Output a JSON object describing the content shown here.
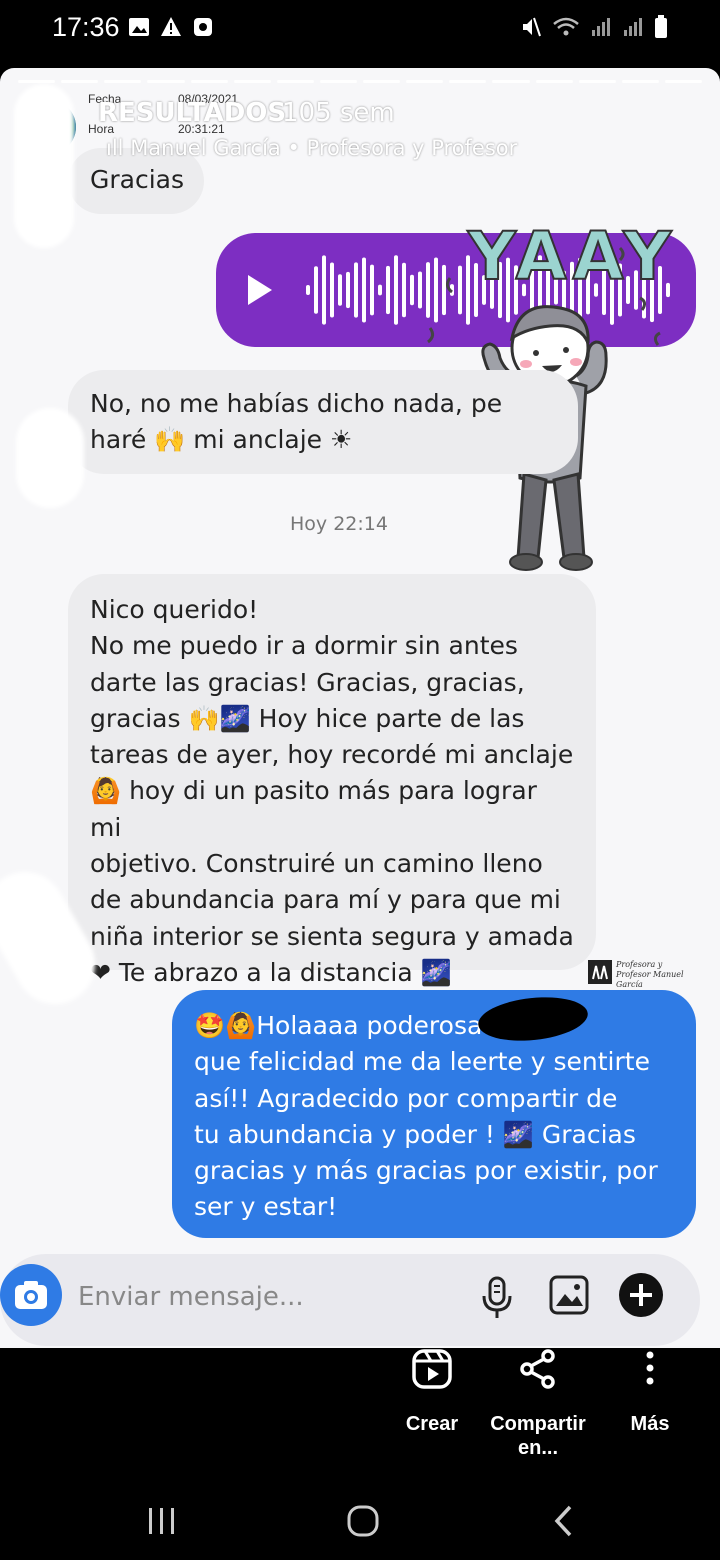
{
  "status_bar": {
    "time": "17:36"
  },
  "story": {
    "account_title": "RESULTADOS",
    "post_age": "105 sem",
    "music": "Manuel García • Profesora y Profesor",
    "meta": {
      "fecha_label": "Fecha",
      "fecha_value": "08/03/2021",
      "hora_label": "Hora",
      "hora_value": "20:31:21"
    },
    "sticker_text": "YAAY",
    "watermark": "Profesora y Profesor Manuel García"
  },
  "chat": {
    "bubble_gracias": "Gracias",
    "bubble_no_me": [
      "No, no me habías dicho nada, pe",
      "haré 🙌 mi anclaje ☀"
    ],
    "timestamp": "Hoy 22:14",
    "bubble_nico": [
      "Nico querido!",
      "No me puedo ir a dormir sin antes",
      "darte las gracias! Gracias, gracias,",
      "gracias 🙌🌌 Hoy hice parte de las",
      "tareas de ayer, hoy recordé mi anclaje",
      "🙆 hoy di un pasito más para lograr mi",
      "objetivo. Construiré un camino lleno",
      "de abundancia para mí y para que mi",
      "niña interior se sienta segura y amada",
      "❤ Te abrazo a la distancia 🌌"
    ],
    "bubble_reply": [
      "🤩🙆Holaaaa poderosa        ! 😍😍",
      "que felicidad me da leerte y sentirte",
      "así!!  Agradecido por compartir de",
      "tu abundancia y poder ! 🌌 Gracias",
      "gracias y más gracias por existir, por",
      "ser y estar!"
    ],
    "composer_placeholder": "Enviar mensaje..."
  },
  "actions": {
    "create": "Crear",
    "share_line1": "Compartir",
    "share_line2": "en...",
    "more": "Más"
  },
  "colors": {
    "outgoing_bubble": "#2f7be5",
    "incoming_bubble": "#ececee",
    "voice_bubble": "#7d2ec2"
  }
}
